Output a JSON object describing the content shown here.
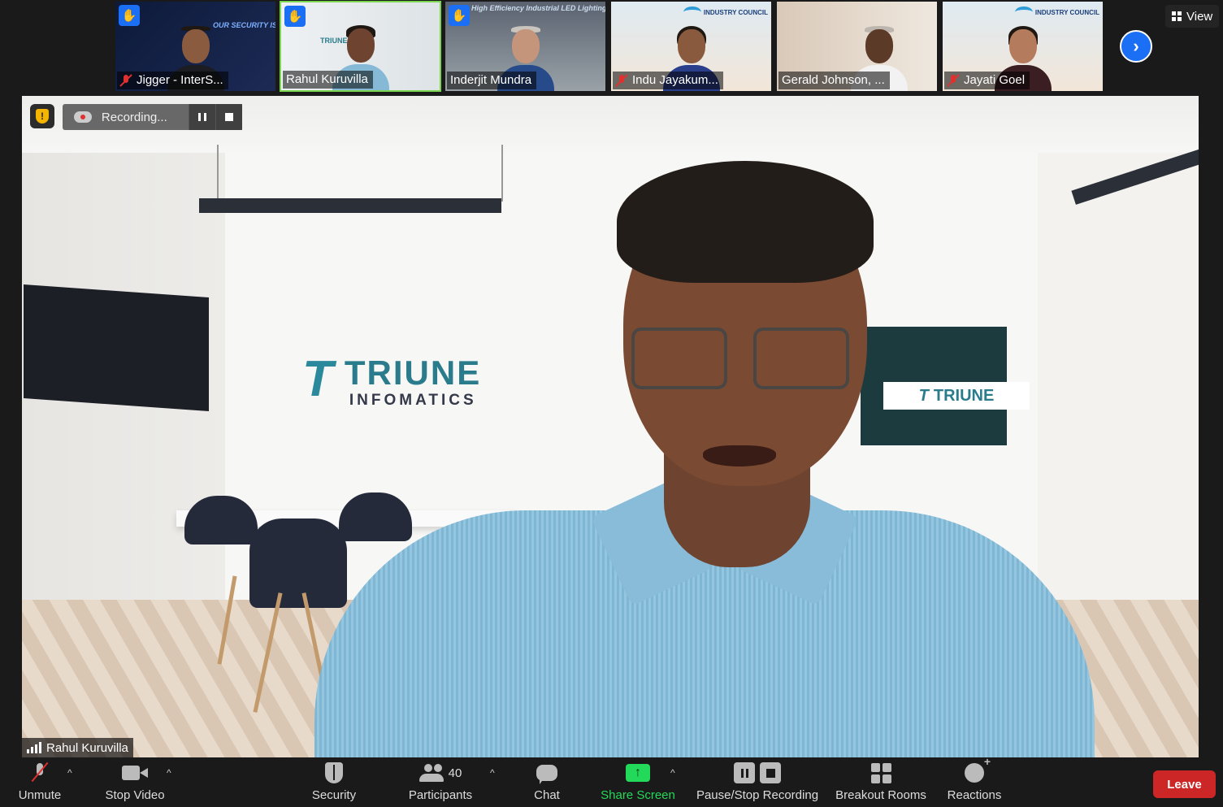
{
  "thumbnails": [
    {
      "name": "Jigger - InterS...",
      "muted": true,
      "hand_raised": true,
      "bg_caption": "OUR SECURITY IS OUR PRIORITY"
    },
    {
      "name": "Rahul Kuruvilla",
      "muted": false,
      "hand_raised": true,
      "active": true,
      "bg_caption": "TRIUNE"
    },
    {
      "name": "Inderjit Mundra",
      "muted": false,
      "hand_raised": true,
      "bg_caption": "High Efficiency Industrial LED Lighting"
    },
    {
      "name": "Indu Jayakum...",
      "muted": true,
      "hand_raised": false,
      "bg_caption": "INDUSTRY COUNCIL"
    },
    {
      "name": "Gerald Johnson, ...",
      "muted": false,
      "hand_raised": false,
      "bg_caption": ""
    },
    {
      "name": "Jayati Goel",
      "muted": true,
      "hand_raised": false,
      "bg_caption": "INDUSTRY COUNCIL"
    }
  ],
  "view_label": "View",
  "main_video": {
    "brand_name": "TRIUNE",
    "brand_sub": "INFOMATICS",
    "brand_mark": "T",
    "poster_text": "TRIUNE",
    "speaker_name": "Rahul Kuruvilla"
  },
  "recording": {
    "label": "Recording..."
  },
  "toolbar": {
    "unmute": "Unmute",
    "stop_video": "Stop Video",
    "security": "Security",
    "participants": "Participants",
    "participants_count": "40",
    "chat": "Chat",
    "share_screen": "Share Screen",
    "pause_stop_recording": "Pause/Stop Recording",
    "breakout_rooms": "Breakout Rooms",
    "reactions": "Reactions",
    "leave": "Leave"
  },
  "colors": {
    "share_green": "#23d959",
    "leave_red": "#cc2626",
    "accent_blue": "#1a6ff5",
    "active_speaker_border": "#7bd64f",
    "muted_red": "#e0302f"
  }
}
